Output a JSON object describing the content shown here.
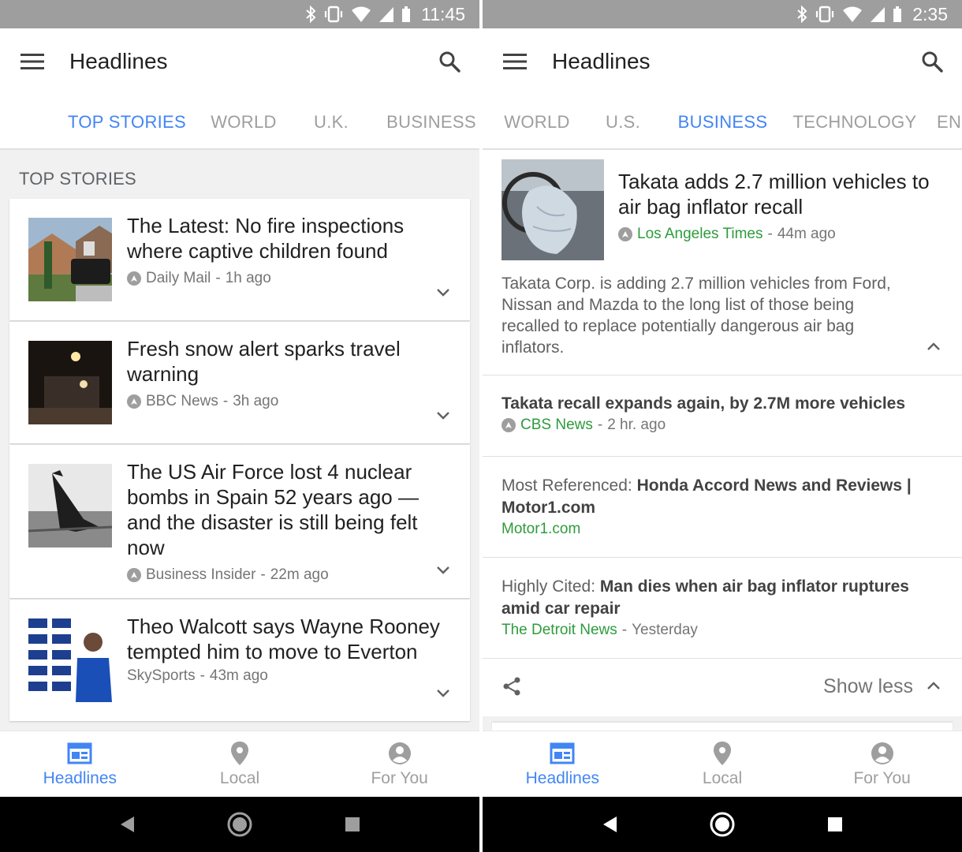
{
  "colors": {
    "accent": "#4285f4",
    "source_green": "#2e9b3c",
    "status_bar": "#9e9e9e",
    "text_primary": "#212121",
    "text_secondary": "#757575"
  },
  "left": {
    "status": {
      "time": "11:45",
      "icons": [
        "bluetooth-icon",
        "vibrate-icon",
        "wifi-icon",
        "signal-icon",
        "battery-icon"
      ]
    },
    "app_title": "Headlines",
    "tabs": [
      {
        "label": "TOP STORIES",
        "active": true
      },
      {
        "label": "WORLD",
        "active": false
      },
      {
        "label": "U.K.",
        "active": false
      },
      {
        "label": "BUSINESS",
        "active": false
      }
    ],
    "section_header": "TOP STORIES",
    "stories": [
      {
        "title": "The Latest: No fire inspections where captive children found",
        "source": "Daily Mail",
        "time": "1h ago",
        "source_icon": true
      },
      {
        "title": "Fresh snow alert sparks travel warning",
        "source": "BBC News",
        "time": "3h ago",
        "source_icon": true
      },
      {
        "title": "The US Air Force lost 4 nuclear bombs in Spain 52 years ago — and the disaster is still being felt now",
        "source": "Business Insider",
        "time": "22m ago",
        "source_icon": true
      },
      {
        "title": "Theo Walcott says Wayne Rooney tempted him to move to Everton",
        "source": "SkySports",
        "time": "43m ago",
        "source_icon": false
      }
    ],
    "nav": [
      {
        "label": "Headlines",
        "icon": "newspaper-icon",
        "active": true
      },
      {
        "label": "Local",
        "icon": "location-pin-icon",
        "active": false
      },
      {
        "label": "For You",
        "icon": "account-icon",
        "active": false
      }
    ]
  },
  "right": {
    "status": {
      "time": "2:35",
      "icons": [
        "bluetooth-icon",
        "vibrate-icon",
        "wifi-icon",
        "signal-icon",
        "battery-icon"
      ]
    },
    "app_title": "Headlines",
    "tabs": [
      {
        "label": "WORLD",
        "active": false
      },
      {
        "label": "U.S.",
        "active": false
      },
      {
        "label": "BUSINESS",
        "active": true
      },
      {
        "label": "TECHNOLOGY",
        "active": false
      },
      {
        "label": "EN",
        "active": false
      }
    ],
    "main_story": {
      "title": "Takata adds 2.7 million vehicles to air bag inflator recall",
      "source": "Los Angeles Times",
      "time": "44m ago",
      "summary": "Takata Corp. is adding 2.7 million vehicles from Ford, Nissan and Mazda to the long list of those being recalled to replace potentially dangerous air bag inflators."
    },
    "related": [
      {
        "prefix": "",
        "title": "Takata recall expands again, by 2.7M more vehicles",
        "source": "CBS News",
        "time": "2 hr. ago"
      },
      {
        "prefix": "Most Referenced: ",
        "title": "Honda Accord News and Reviews | Motor1.com",
        "source": "Motor1.com",
        "time": ""
      },
      {
        "prefix": "Highly Cited: ",
        "title": "Man dies when air bag inflator ruptures amid car repair",
        "source": "The Detroit News",
        "time": "Yesterday"
      }
    ],
    "show_less_label": "Show less",
    "nav": [
      {
        "label": "Headlines",
        "icon": "newspaper-icon",
        "active": true
      },
      {
        "label": "Local",
        "icon": "location-pin-icon",
        "active": false
      },
      {
        "label": "For You",
        "icon": "account-icon",
        "active": false
      }
    ]
  }
}
